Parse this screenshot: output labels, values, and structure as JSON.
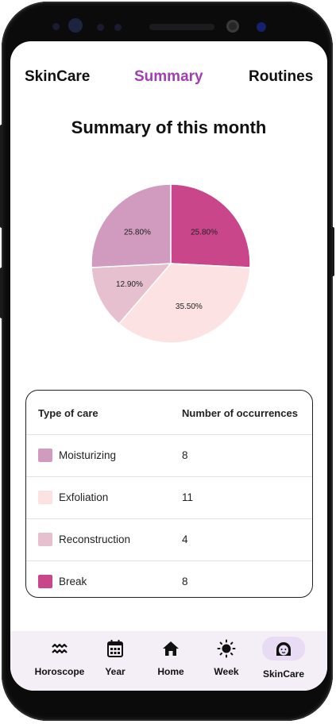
{
  "tabs": [
    {
      "label": "SkinCare"
    },
    {
      "label": "Summary",
      "active": true
    },
    {
      "label": "Routines"
    }
  ],
  "page_title": "Summary of this month",
  "chart_data": {
    "type": "pie",
    "slices": [
      {
        "label": "Break",
        "value": 25.8,
        "text": "25.80%",
        "color": "#c9468a"
      },
      {
        "label": "Exfoliation",
        "value": 35.5,
        "text": "35.50%",
        "color": "#fce2e2"
      },
      {
        "label": "Reconstruction",
        "value": 12.9,
        "text": "12.90%",
        "color": "#e6c0cf"
      },
      {
        "label": "Moisturizing",
        "value": 25.8,
        "text": "25.80%",
        "color": "#d19bbf"
      }
    ]
  },
  "table": {
    "headers": {
      "type": "Type of care",
      "count": "Number of occurrences"
    },
    "rows": [
      {
        "name": "Moisturizing",
        "count": "8",
        "color": "#d19bbf"
      },
      {
        "name": "Exfoliation",
        "count": "11",
        "color": "#fce2e2"
      },
      {
        "name": "Reconstruction",
        "count": "4",
        "color": "#e6c0cf"
      },
      {
        "name": "Break",
        "count": "8",
        "color": "#c9468a"
      }
    ]
  },
  "nav": [
    {
      "label": "Horoscope",
      "icon": "aquarius-icon"
    },
    {
      "label": "Year",
      "icon": "calendar-icon"
    },
    {
      "label": "Home",
      "icon": "home-icon"
    },
    {
      "label": "Week",
      "icon": "sun-icon"
    },
    {
      "label": "SkinCare",
      "icon": "face-icon",
      "active": true
    }
  ],
  "colors": {
    "accent": "#a040b0",
    "nav_bg": "#f4eef6",
    "nav_active": "#e8dbf4"
  }
}
